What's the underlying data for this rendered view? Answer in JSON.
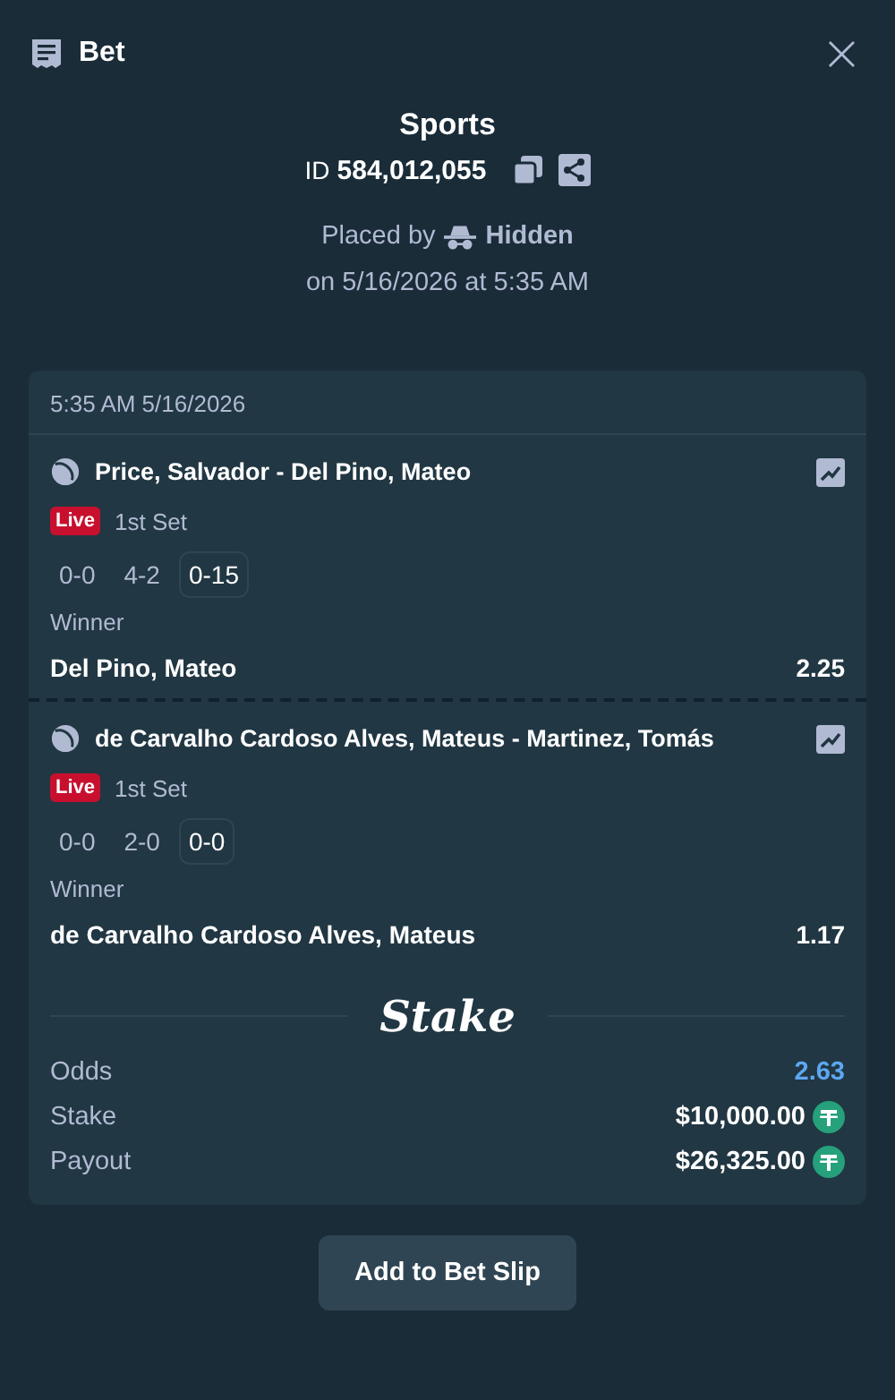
{
  "header": {
    "title": "Bet",
    "close": "×"
  },
  "summary": {
    "category": "Sports",
    "id_label": "ID",
    "id_value": "584,012,055",
    "placed_by_label": "Placed by",
    "placed_by_user": "Hidden",
    "placed_on": "on 5/16/2026 at 5:35 AM"
  },
  "card": {
    "timestamp": "5:35 AM 5/16/2026",
    "legs": [
      {
        "match": "Price, Salvador - Del Pino, Mateo",
        "status": "Live",
        "period": "1st Set",
        "scores": [
          {
            "text": "0-0",
            "current": false
          },
          {
            "text": "4-2",
            "current": false
          },
          {
            "text": "0-15",
            "current": true
          }
        ],
        "market": "Winner",
        "selection": "Del Pino, Mateo",
        "odds": "2.25"
      },
      {
        "match": "de Carvalho Cardoso Alves, Mateus - Martinez, Tomás",
        "status": "Live",
        "period": "1st Set",
        "scores": [
          {
            "text": "0-0",
            "current": false
          },
          {
            "text": "2-0",
            "current": false
          },
          {
            "text": "0-0",
            "current": true
          }
        ],
        "market": "Winner",
        "selection": "de Carvalho Cardoso Alves, Mateus",
        "odds": "1.17"
      }
    ],
    "brand": "Stake",
    "totals": [
      {
        "label": "Odds",
        "value": "2.63",
        "kind": "odds"
      },
      {
        "label": "Stake",
        "value": "$10,000.00",
        "kind": "money"
      },
      {
        "label": "Payout",
        "value": "$26,325.00",
        "kind": "money"
      }
    ]
  },
  "action": {
    "label": "Add to Bet Slip"
  }
}
